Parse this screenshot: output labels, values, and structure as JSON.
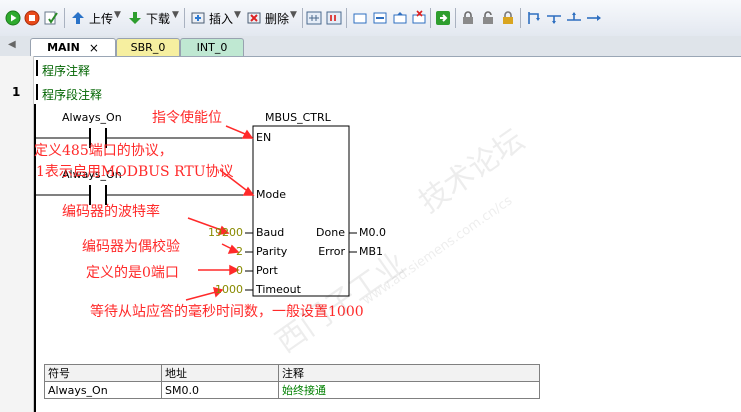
{
  "toolbar": {
    "upload_label": "上传",
    "download_label": "下载",
    "insert_label": "插入",
    "delete_label": "删除"
  },
  "tabs": [
    {
      "label": "MAIN",
      "close": "×"
    },
    {
      "label": "SBR_0"
    },
    {
      "label": "INT_0"
    }
  ],
  "program": {
    "title": "程序注释",
    "network_number": "1",
    "network_title": "程序段注释"
  },
  "contacts": {
    "top": "Always_On",
    "mid": "Always_On"
  },
  "block": {
    "name": "MBUS_CTRL",
    "pins_in": [
      "EN",
      "Mode",
      "Baud",
      "Parity",
      "Port",
      "Timeout"
    ],
    "pins_out": [
      "Done",
      "Error"
    ],
    "values_in": {
      "baud": "19200",
      "parity": "2",
      "port": "0",
      "timeout": "1000"
    },
    "values_out": {
      "done": "M0.0",
      "error": "MB1"
    }
  },
  "annotations": {
    "en": "指令使能位",
    "mode_line1": "定义485端口的协议，",
    "mode_line2": "1表示启用MODBUS RTU协议",
    "baud": "编码器的波特率",
    "parity": "编码器为偶校验",
    "port": "定义的是0端口",
    "timeout": "等待从站应答的毫秒时间数，一般设置1000"
  },
  "symbol_table": {
    "headers": [
      "符号",
      "地址",
      "注释"
    ],
    "rows": [
      [
        "Always_On",
        "SM0.0",
        "始终接通"
      ]
    ]
  },
  "watermark": {
    "line1": "西门子工业",
    "line2": "技术论坛",
    "url": "www.ad.siemens.com.cn/cs"
  },
  "colors": {
    "annotation": "#ff2a2a",
    "value": "#888a00",
    "comment": "#008000"
  }
}
